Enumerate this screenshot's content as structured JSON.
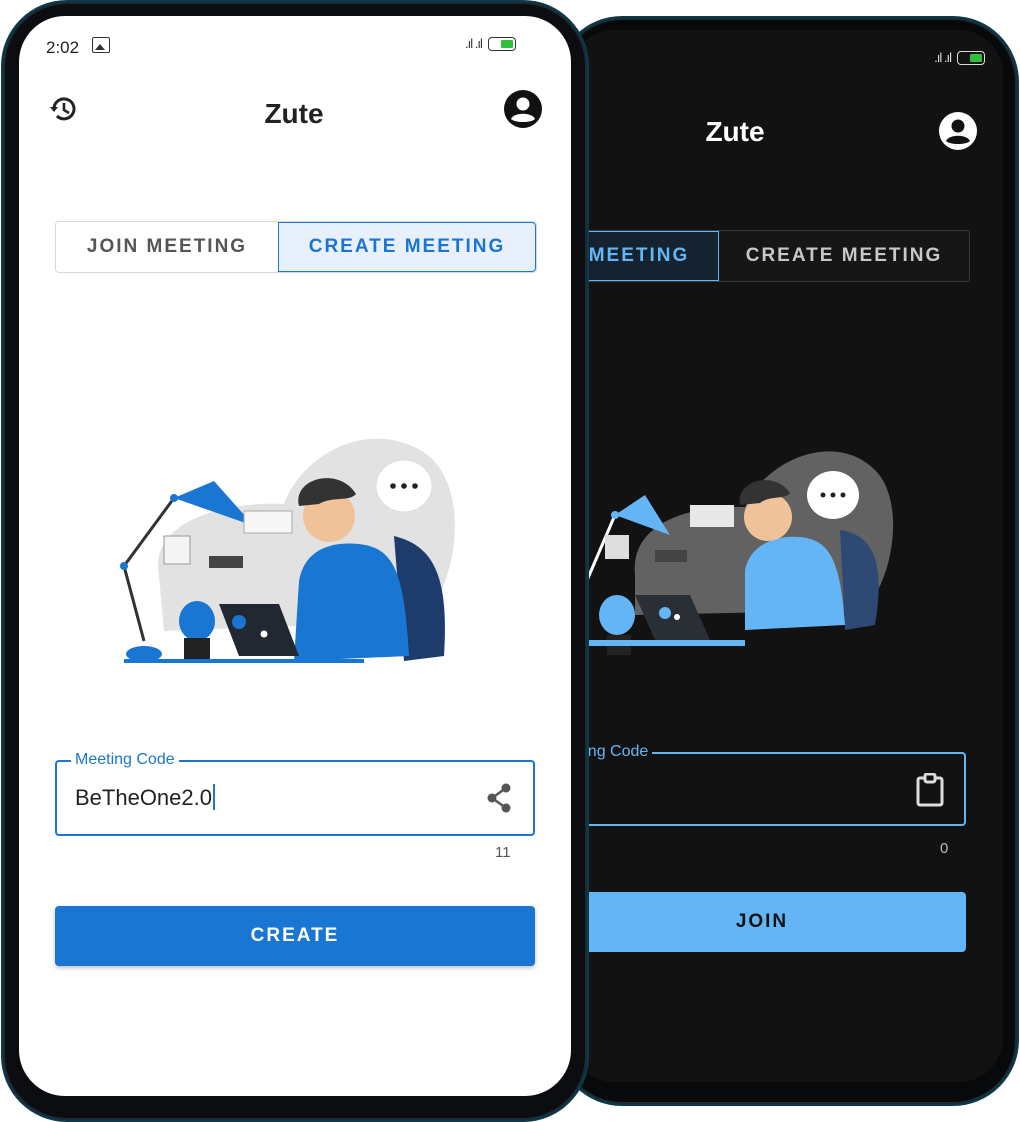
{
  "colors": {
    "accent": "#1976d2",
    "accent_dark_mode": "#64b5f6",
    "light_bg": "#ffffff",
    "dark_bg": "#121212"
  },
  "light_phone": {
    "status": {
      "time": "2:02",
      "signal": ".ıl .ıl"
    },
    "app_title": "Zute",
    "icons": {
      "left": "history-icon",
      "right": "account-circle-icon"
    },
    "tabs": [
      {
        "label": "JOIN MEETING",
        "active": false
      },
      {
        "label": "CREATE MEETING",
        "active": true
      }
    ],
    "field": {
      "label": "Meeting Code",
      "value": "BeTheOne2.0",
      "icon": "share-icon",
      "counter": "11"
    },
    "button_label": "CREATE"
  },
  "dark_phone": {
    "status": {
      "signal": ".ıl .ıl"
    },
    "app_title": "Zute",
    "icons": {
      "right": "account-circle-icon"
    },
    "tabs": [
      {
        "label": "MEETING",
        "active": true
      },
      {
        "label": "CREATE MEETING",
        "active": false
      }
    ],
    "field": {
      "label": "eeting Code",
      "value": "",
      "icon": "clipboard-icon",
      "counter": "0"
    },
    "button_label": "JOIN"
  }
}
